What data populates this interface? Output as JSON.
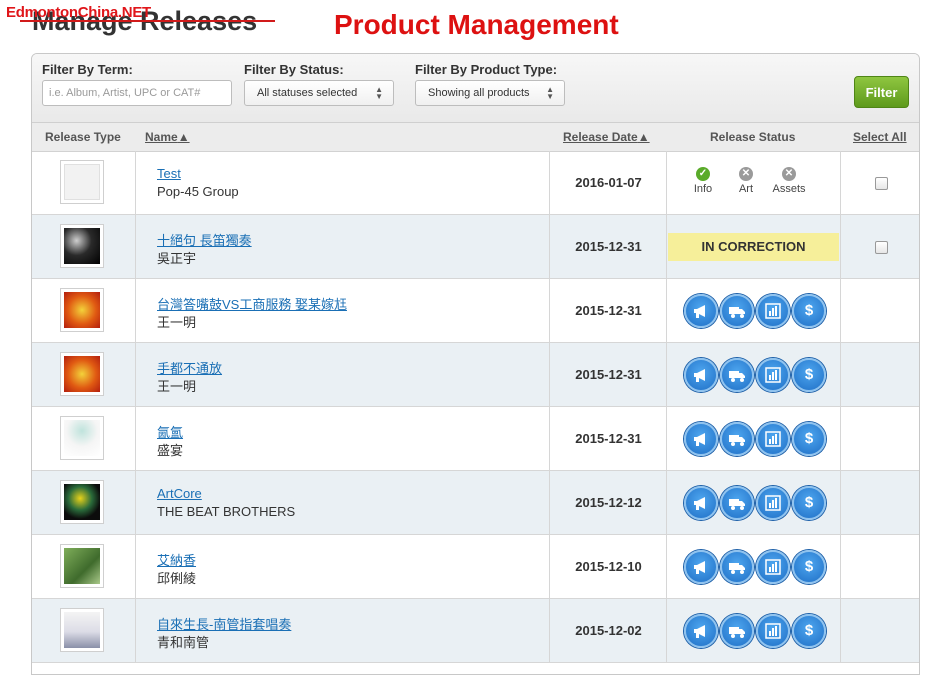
{
  "watermark": "EdmontonChina.NET",
  "page_title": "Manage Releases",
  "annotation": "Product Management",
  "filters": {
    "term_label": "Filter By Term:",
    "term_placeholder": "i.e. Album, Artist, UPC or CAT#",
    "status_label": "Filter By Status:",
    "status_value": "All statuses selected",
    "type_label": "Filter By Product Type:",
    "type_value": "Showing all products",
    "button": "Filter"
  },
  "columns": {
    "type": "Release Type",
    "name": "Name",
    "date": "Release Date",
    "status": "Release Status",
    "select": "Select All"
  },
  "status_labels": {
    "info": "Info",
    "art": "Art",
    "assets": "Assets",
    "correction": "IN CORRECTION"
  },
  "rows": [
    {
      "name": "Test",
      "artist": "Pop-45 Group",
      "date": "2016-01-07"
    },
    {
      "name": "十絕句 長笛獨奏",
      "artist": "吳正宇",
      "date": "2015-12-31"
    },
    {
      "name": "台灣答嘴鼓VS工商服務 娶某嫁尪",
      "artist": "王一明",
      "date": "2015-12-31"
    },
    {
      "name": "手都不通放",
      "artist": "王一明",
      "date": "2015-12-31"
    },
    {
      "name": "氤氳",
      "artist": "盛宴",
      "date": "2015-12-31"
    },
    {
      "name": "ArtCore",
      "artist": "THE BEAT BROTHERS",
      "date": "2015-12-12"
    },
    {
      "name": "艾納香",
      "artist": "邱俐綾",
      "date": "2015-12-10"
    },
    {
      "name": "自來生長-南管指套唱奏",
      "artist": "青和南管",
      "date": "2015-12-02"
    }
  ],
  "colors": {
    "accent_green": "#6aa52a",
    "link_blue": "#1a6fb5",
    "correction_yellow": "#f6ef9a",
    "annotation_red": "#dd1111"
  }
}
